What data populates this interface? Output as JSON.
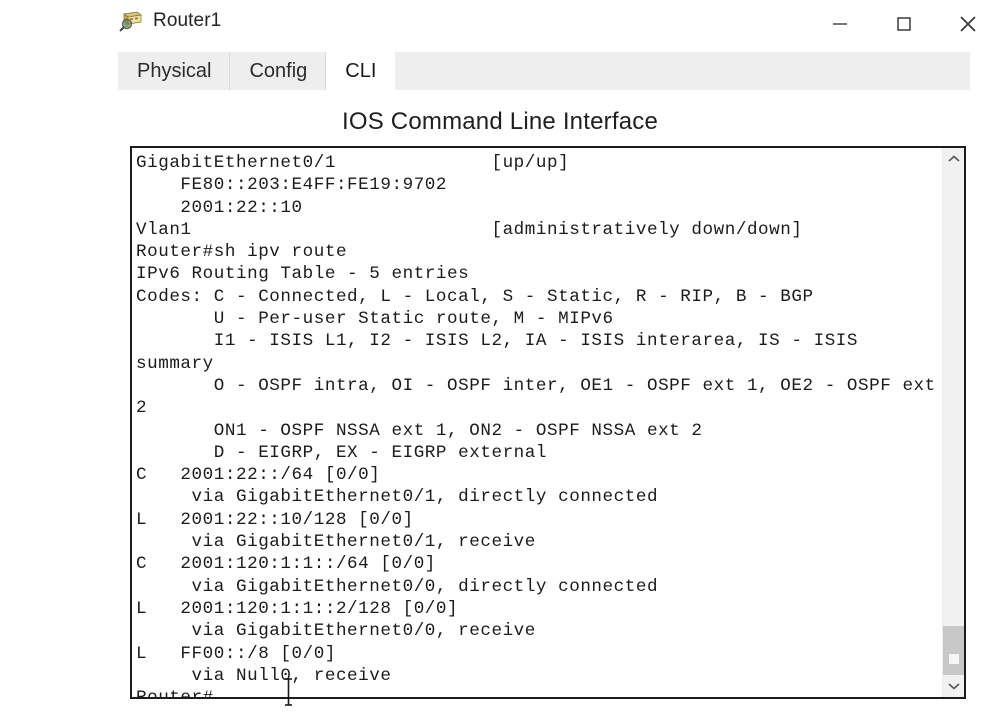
{
  "window": {
    "title": "Router1",
    "icon": "router-device-icon",
    "controls": {
      "minimize": "minimize-icon",
      "maximize": "maximize-icon",
      "close": "close-icon"
    }
  },
  "tabs": [
    {
      "label": "Physical",
      "active": false
    },
    {
      "label": "Config",
      "active": false
    },
    {
      "label": "CLI",
      "active": true
    }
  ],
  "heading": "IOS Command Line Interface",
  "terminal": {
    "lines": [
      "GigabitEthernet0/1              [up/up]",
      "    FE80::203:E4FF:FE19:9702",
      "    2001:22::10",
      "Vlan1                           [administratively down/down]",
      "Router#sh ipv route",
      "IPv6 Routing Table - 5 entries",
      "Codes: C - Connected, L - Local, S - Static, R - RIP, B - BGP",
      "       U - Per-user Static route, M - MIPv6",
      "       I1 - ISIS L1, I2 - ISIS L2, IA - ISIS interarea, IS - ISIS",
      "summary",
      "       O - OSPF intra, OI - OSPF inter, OE1 - OSPF ext 1, OE2 - OSPF ext",
      "2",
      "       ON1 - OSPF NSSA ext 1, ON2 - OSPF NSSA ext 2",
      "       D - EIGRP, EX - EIGRP external",
      "C   2001:22::/64 [0/0]",
      "     via GigabitEthernet0/1, directly connected",
      "L   2001:22::10/128 [0/0]",
      "     via GigabitEthernet0/1, receive",
      "C   2001:120:1:1::/64 [0/0]",
      "     via GigabitEthernet0/0, directly connected",
      "L   2001:120:1:1::2/128 [0/0]",
      "     via GigabitEthernet0/0, receive",
      "L   FF00::/8 [0/0]",
      "     via Null0, receive",
      "Router#"
    ]
  },
  "scrollbar": {
    "up_arrow": "chevron-up-icon",
    "down_arrow": "chevron-down-icon",
    "thumb": "scroll-thumb"
  },
  "cursor": {
    "type": "text-ibeam-cursor"
  },
  "colors": {
    "tabstrip_bg": "#eeeeee",
    "terminal_border": "#1c1c1c",
    "terminal_text": "#1b1b1b",
    "scroll_thumb": "#c8c8c8",
    "window_bg": "#ffffff"
  }
}
